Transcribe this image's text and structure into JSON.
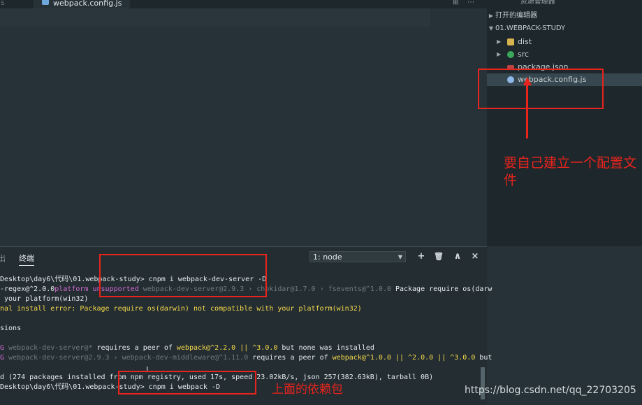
{
  "editor": {
    "tabs": [
      {
        "label": "gs"
      },
      {
        "label": "webpack.config.js",
        "close": "×"
      }
    ]
  },
  "explorer": {
    "header": "资源管理器",
    "open_editors": "打开的编辑器",
    "project": "01.WEBPACK-STUDY",
    "items": [
      {
        "label": "dist",
        "icon": "folder-icon"
      },
      {
        "label": "src",
        "icon": "src-folder-icon"
      },
      {
        "label": "package.json",
        "icon": "json-file-icon"
      },
      {
        "label": "webpack.config.js",
        "icon": "webpack-file-icon",
        "selected": true
      }
    ]
  },
  "panel": {
    "prev_tab": "出",
    "tab": "终端",
    "terminal_select": "1: node",
    "buttons": {
      "add": "+",
      "trash": "🗑",
      "maximize": "∧",
      "close": "×"
    }
  },
  "terminal": {
    "l1": "Desktop\\day6\\代码\\01.webpack-study> cnpm i webpack-dev-server -D",
    "l2a": "-regex@^2.0.0",
    "l2b": "platform unsupported",
    "l2c": " webpack-dev-server@2.9.3 › chokidar@1.7.0 › fsevents@^1.0.0",
    "l2d": " Package require os(darw",
    "l3": " your platform(win32)",
    "l4": "nal install error: Package require os(darwin) not compatible with your platform(win32)",
    "l5": "sions",
    "l6a": "G",
    "l6b": " webpack-dev-server@*",
    "l6c": " requires a peer of ",
    "l6d": "webpack@^2.2.0 || ^3.0.0",
    "l6e": " but none was installed",
    "l7a": "G",
    "l7b": " webpack-dev-server@2.9.3 › webpack-dev-middleware@^1.11.0",
    "l7c": " requires a peer of ",
    "l7d": "webpack@^1.0.0 || ^2.0.0 || ^3.0.0",
    "l7e": " but",
    "l8": "d (274 packages installed from npm registry, used 17s, speed 23.02kB/s, json 257(382.63kB), tarball 0B)",
    "l9": "Desktop\\day6\\代码\\01.webpack-study> cnpm i webpack -D"
  },
  "annotations": {
    "config_note": "要自己建立一个配置文件",
    "deps_note": "上面的依赖包"
  },
  "watermark": "https://blog.csdn.net/qq_22703205",
  "colors": {
    "annotation_red": "#e8241c",
    "warn_yellow": "#f7d94c"
  }
}
